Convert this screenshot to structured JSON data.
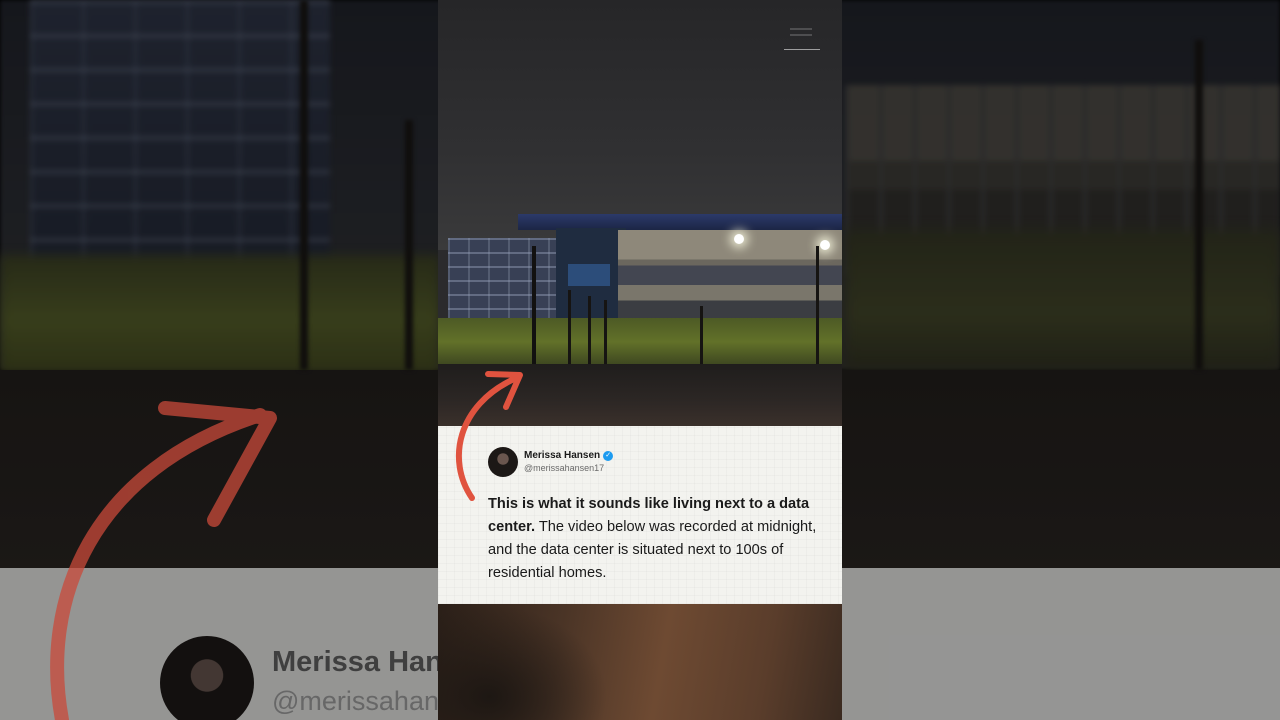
{
  "tweet": {
    "author_name": "Merissa Hansen",
    "author_handle": "@merissahansen17",
    "text_bold": "This is what it sounds like living next to a data center.",
    "text_regular": " The video below was recorded at midnight, and the data center is situated next to 100s of residential homes."
  },
  "background_card": {
    "author_name": "Merissa Han",
    "author_handle": "@merissahan"
  },
  "icons": {
    "verified": "verified-badge-icon",
    "arrow": "red-arrow-annotation"
  },
  "colors": {
    "arrow": "#e0533f",
    "verified": "#1d9bf0",
    "card": "#f3f3ef"
  }
}
